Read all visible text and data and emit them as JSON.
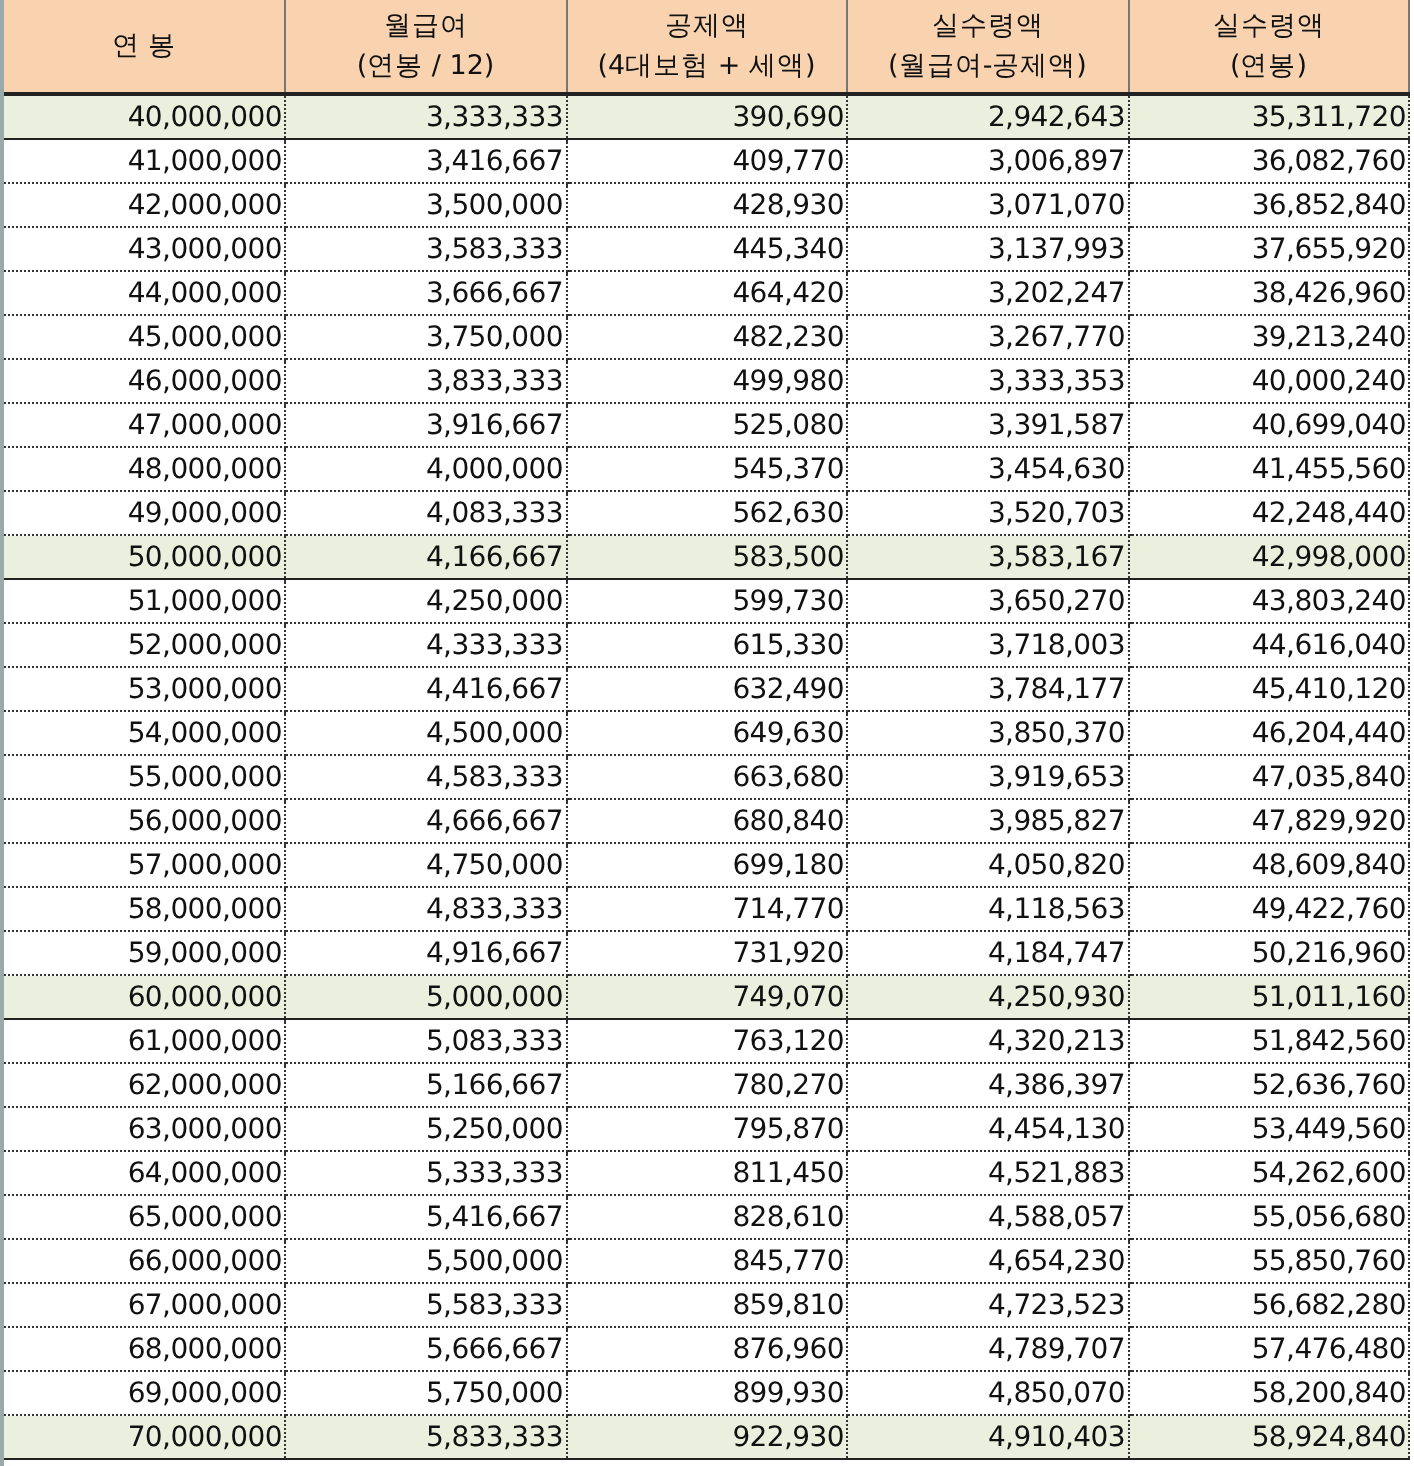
{
  "table": {
    "columns": [
      {
        "title": "연 봉"
      },
      {
        "title": "월급여",
        "subtitle": "(연봉 / 12)"
      },
      {
        "title": "공제액",
        "subtitle": "(4대보험 + 세액)"
      },
      {
        "title": "실수령액",
        "subtitle": "(월급여-공제액)"
      },
      {
        "title": "실수령액",
        "subtitle": "(연봉)"
      }
    ],
    "rows": [
      {
        "cells": [
          "40,000,000",
          "3,333,333",
          "390,690",
          "2,942,643",
          "35,311,720"
        ],
        "highlighted": true
      },
      {
        "cells": [
          "41,000,000",
          "3,416,667",
          "409,770",
          "3,006,897",
          "36,082,760"
        ],
        "highlighted": false
      },
      {
        "cells": [
          "42,000,000",
          "3,500,000",
          "428,930",
          "3,071,070",
          "36,852,840"
        ],
        "highlighted": false
      },
      {
        "cells": [
          "43,000,000",
          "3,583,333",
          "445,340",
          "3,137,993",
          "37,655,920"
        ],
        "highlighted": false
      },
      {
        "cells": [
          "44,000,000",
          "3,666,667",
          "464,420",
          "3,202,247",
          "38,426,960"
        ],
        "highlighted": false
      },
      {
        "cells": [
          "45,000,000",
          "3,750,000",
          "482,230",
          "3,267,770",
          "39,213,240"
        ],
        "highlighted": false
      },
      {
        "cells": [
          "46,000,000",
          "3,833,333",
          "499,980",
          "3,333,353",
          "40,000,240"
        ],
        "highlighted": false
      },
      {
        "cells": [
          "47,000,000",
          "3,916,667",
          "525,080",
          "3,391,587",
          "40,699,040"
        ],
        "highlighted": false
      },
      {
        "cells": [
          "48,000,000",
          "4,000,000",
          "545,370",
          "3,454,630",
          "41,455,560"
        ],
        "highlighted": false
      },
      {
        "cells": [
          "49,000,000",
          "4,083,333",
          "562,630",
          "3,520,703",
          "42,248,440"
        ],
        "highlighted": false
      },
      {
        "cells": [
          "50,000,000",
          "4,166,667",
          "583,500",
          "3,583,167",
          "42,998,000"
        ],
        "highlighted": true
      },
      {
        "cells": [
          "51,000,000",
          "4,250,000",
          "599,730",
          "3,650,270",
          "43,803,240"
        ],
        "highlighted": false
      },
      {
        "cells": [
          "52,000,000",
          "4,333,333",
          "615,330",
          "3,718,003",
          "44,616,040"
        ],
        "highlighted": false
      },
      {
        "cells": [
          "53,000,000",
          "4,416,667",
          "632,490",
          "3,784,177",
          "45,410,120"
        ],
        "highlighted": false
      },
      {
        "cells": [
          "54,000,000",
          "4,500,000",
          "649,630",
          "3,850,370",
          "46,204,440"
        ],
        "highlighted": false
      },
      {
        "cells": [
          "55,000,000",
          "4,583,333",
          "663,680",
          "3,919,653",
          "47,035,840"
        ],
        "highlighted": false
      },
      {
        "cells": [
          "56,000,000",
          "4,666,667",
          "680,840",
          "3,985,827",
          "47,829,920"
        ],
        "highlighted": false
      },
      {
        "cells": [
          "57,000,000",
          "4,750,000",
          "699,180",
          "4,050,820",
          "48,609,840"
        ],
        "highlighted": false
      },
      {
        "cells": [
          "58,000,000",
          "4,833,333",
          "714,770",
          "4,118,563",
          "49,422,760"
        ],
        "highlighted": false
      },
      {
        "cells": [
          "59,000,000",
          "4,916,667",
          "731,920",
          "4,184,747",
          "50,216,960"
        ],
        "highlighted": false
      },
      {
        "cells": [
          "60,000,000",
          "5,000,000",
          "749,070",
          "4,250,930",
          "51,011,160"
        ],
        "highlighted": true
      },
      {
        "cells": [
          "61,000,000",
          "5,083,333",
          "763,120",
          "4,320,213",
          "51,842,560"
        ],
        "highlighted": false
      },
      {
        "cells": [
          "62,000,000",
          "5,166,667",
          "780,270",
          "4,386,397",
          "52,636,760"
        ],
        "highlighted": false
      },
      {
        "cells": [
          "63,000,000",
          "5,250,000",
          "795,870",
          "4,454,130",
          "53,449,560"
        ],
        "highlighted": false
      },
      {
        "cells": [
          "64,000,000",
          "5,333,333",
          "811,450",
          "4,521,883",
          "54,262,600"
        ],
        "highlighted": false
      },
      {
        "cells": [
          "65,000,000",
          "5,416,667",
          "828,610",
          "4,588,057",
          "55,056,680"
        ],
        "highlighted": false
      },
      {
        "cells": [
          "66,000,000",
          "5,500,000",
          "845,770",
          "4,654,230",
          "55,850,760"
        ],
        "highlighted": false
      },
      {
        "cells": [
          "67,000,000",
          "5,583,333",
          "859,810",
          "4,723,523",
          "56,682,280"
        ],
        "highlighted": false
      },
      {
        "cells": [
          "68,000,000",
          "5,666,667",
          "876,960",
          "4,789,707",
          "57,476,480"
        ],
        "highlighted": false
      },
      {
        "cells": [
          "69,000,000",
          "5,750,000",
          "899,930",
          "4,850,070",
          "58,200,840"
        ],
        "highlighted": false
      },
      {
        "cells": [
          "70,000,000",
          "5,833,333",
          "922,930",
          "4,910,403",
          "58,924,840"
        ],
        "highlighted": true
      }
    ]
  }
}
